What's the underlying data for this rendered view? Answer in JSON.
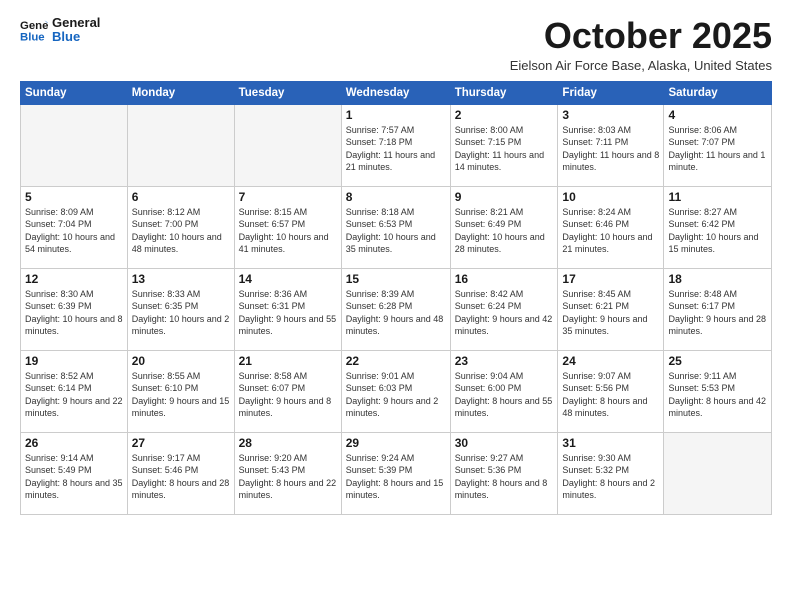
{
  "logo": {
    "general": "General",
    "blue": "Blue"
  },
  "header": {
    "title": "October 2025",
    "subtitle": "Eielson Air Force Base, Alaska, United States"
  },
  "weekdays": [
    "Sunday",
    "Monday",
    "Tuesday",
    "Wednesday",
    "Thursday",
    "Friday",
    "Saturday"
  ],
  "weeks": [
    [
      {
        "day": "",
        "sunrise": "",
        "sunset": "",
        "daylight": ""
      },
      {
        "day": "",
        "sunrise": "",
        "sunset": "",
        "daylight": ""
      },
      {
        "day": "",
        "sunrise": "",
        "sunset": "",
        "daylight": ""
      },
      {
        "day": "1",
        "sunrise": "Sunrise: 7:57 AM",
        "sunset": "Sunset: 7:18 PM",
        "daylight": "Daylight: 11 hours and 21 minutes."
      },
      {
        "day": "2",
        "sunrise": "Sunrise: 8:00 AM",
        "sunset": "Sunset: 7:15 PM",
        "daylight": "Daylight: 11 hours and 14 minutes."
      },
      {
        "day": "3",
        "sunrise": "Sunrise: 8:03 AM",
        "sunset": "Sunset: 7:11 PM",
        "daylight": "Daylight: 11 hours and 8 minutes."
      },
      {
        "day": "4",
        "sunrise": "Sunrise: 8:06 AM",
        "sunset": "Sunset: 7:07 PM",
        "daylight": "Daylight: 11 hours and 1 minute."
      }
    ],
    [
      {
        "day": "5",
        "sunrise": "Sunrise: 8:09 AM",
        "sunset": "Sunset: 7:04 PM",
        "daylight": "Daylight: 10 hours and 54 minutes."
      },
      {
        "day": "6",
        "sunrise": "Sunrise: 8:12 AM",
        "sunset": "Sunset: 7:00 PM",
        "daylight": "Daylight: 10 hours and 48 minutes."
      },
      {
        "day": "7",
        "sunrise": "Sunrise: 8:15 AM",
        "sunset": "Sunset: 6:57 PM",
        "daylight": "Daylight: 10 hours and 41 minutes."
      },
      {
        "day": "8",
        "sunrise": "Sunrise: 8:18 AM",
        "sunset": "Sunset: 6:53 PM",
        "daylight": "Daylight: 10 hours and 35 minutes."
      },
      {
        "day": "9",
        "sunrise": "Sunrise: 8:21 AM",
        "sunset": "Sunset: 6:49 PM",
        "daylight": "Daylight: 10 hours and 28 minutes."
      },
      {
        "day": "10",
        "sunrise": "Sunrise: 8:24 AM",
        "sunset": "Sunset: 6:46 PM",
        "daylight": "Daylight: 10 hours and 21 minutes."
      },
      {
        "day": "11",
        "sunrise": "Sunrise: 8:27 AM",
        "sunset": "Sunset: 6:42 PM",
        "daylight": "Daylight: 10 hours and 15 minutes."
      }
    ],
    [
      {
        "day": "12",
        "sunrise": "Sunrise: 8:30 AM",
        "sunset": "Sunset: 6:39 PM",
        "daylight": "Daylight: 10 hours and 8 minutes."
      },
      {
        "day": "13",
        "sunrise": "Sunrise: 8:33 AM",
        "sunset": "Sunset: 6:35 PM",
        "daylight": "Daylight: 10 hours and 2 minutes."
      },
      {
        "day": "14",
        "sunrise": "Sunrise: 8:36 AM",
        "sunset": "Sunset: 6:31 PM",
        "daylight": "Daylight: 9 hours and 55 minutes."
      },
      {
        "day": "15",
        "sunrise": "Sunrise: 8:39 AM",
        "sunset": "Sunset: 6:28 PM",
        "daylight": "Daylight: 9 hours and 48 minutes."
      },
      {
        "day": "16",
        "sunrise": "Sunrise: 8:42 AM",
        "sunset": "Sunset: 6:24 PM",
        "daylight": "Daylight: 9 hours and 42 minutes."
      },
      {
        "day": "17",
        "sunrise": "Sunrise: 8:45 AM",
        "sunset": "Sunset: 6:21 PM",
        "daylight": "Daylight: 9 hours and 35 minutes."
      },
      {
        "day": "18",
        "sunrise": "Sunrise: 8:48 AM",
        "sunset": "Sunset: 6:17 PM",
        "daylight": "Daylight: 9 hours and 28 minutes."
      }
    ],
    [
      {
        "day": "19",
        "sunrise": "Sunrise: 8:52 AM",
        "sunset": "Sunset: 6:14 PM",
        "daylight": "Daylight: 9 hours and 22 minutes."
      },
      {
        "day": "20",
        "sunrise": "Sunrise: 8:55 AM",
        "sunset": "Sunset: 6:10 PM",
        "daylight": "Daylight: 9 hours and 15 minutes."
      },
      {
        "day": "21",
        "sunrise": "Sunrise: 8:58 AM",
        "sunset": "Sunset: 6:07 PM",
        "daylight": "Daylight: 9 hours and 8 minutes."
      },
      {
        "day": "22",
        "sunrise": "Sunrise: 9:01 AM",
        "sunset": "Sunset: 6:03 PM",
        "daylight": "Daylight: 9 hours and 2 minutes."
      },
      {
        "day": "23",
        "sunrise": "Sunrise: 9:04 AM",
        "sunset": "Sunset: 6:00 PM",
        "daylight": "Daylight: 8 hours and 55 minutes."
      },
      {
        "day": "24",
        "sunrise": "Sunrise: 9:07 AM",
        "sunset": "Sunset: 5:56 PM",
        "daylight": "Daylight: 8 hours and 48 minutes."
      },
      {
        "day": "25",
        "sunrise": "Sunrise: 9:11 AM",
        "sunset": "Sunset: 5:53 PM",
        "daylight": "Daylight: 8 hours and 42 minutes."
      }
    ],
    [
      {
        "day": "26",
        "sunrise": "Sunrise: 9:14 AM",
        "sunset": "Sunset: 5:49 PM",
        "daylight": "Daylight: 8 hours and 35 minutes."
      },
      {
        "day": "27",
        "sunrise": "Sunrise: 9:17 AM",
        "sunset": "Sunset: 5:46 PM",
        "daylight": "Daylight: 8 hours and 28 minutes."
      },
      {
        "day": "28",
        "sunrise": "Sunrise: 9:20 AM",
        "sunset": "Sunset: 5:43 PM",
        "daylight": "Daylight: 8 hours and 22 minutes."
      },
      {
        "day": "29",
        "sunrise": "Sunrise: 9:24 AM",
        "sunset": "Sunset: 5:39 PM",
        "daylight": "Daylight: 8 hours and 15 minutes."
      },
      {
        "day": "30",
        "sunrise": "Sunrise: 9:27 AM",
        "sunset": "Sunset: 5:36 PM",
        "daylight": "Daylight: 8 hours and 8 minutes."
      },
      {
        "day": "31",
        "sunrise": "Sunrise: 9:30 AM",
        "sunset": "Sunset: 5:32 PM",
        "daylight": "Daylight: 8 hours and 2 minutes."
      },
      {
        "day": "",
        "sunrise": "",
        "sunset": "",
        "daylight": ""
      }
    ]
  ]
}
